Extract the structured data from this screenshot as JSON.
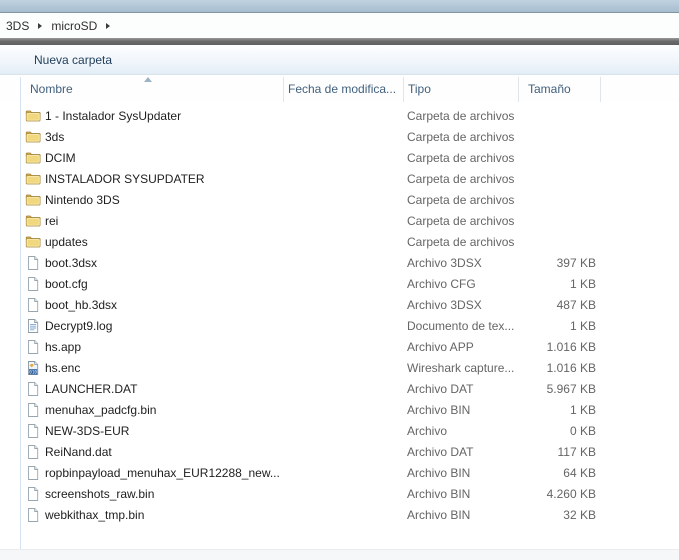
{
  "breadcrumb": {
    "items": [
      "3DS",
      "microSD"
    ]
  },
  "toolbar": {
    "buttons": [
      {
        "label": "Nueva carpeta"
      }
    ]
  },
  "list": {
    "columns": [
      {
        "label": "Nombre"
      },
      {
        "label": "Fecha de modifica..."
      },
      {
        "label": "Tipo"
      },
      {
        "label": "Tamaño"
      }
    ],
    "sort": {
      "column": "Nombre",
      "direction": "asc"
    },
    "files": [
      {
        "name": "1 - Instalador SysUpdater",
        "type": "Carpeta de archivos",
        "size": "",
        "icon": "folder"
      },
      {
        "name": "3ds",
        "type": "Carpeta de archivos",
        "size": "",
        "icon": "folder"
      },
      {
        "name": "DCIM",
        "type": "Carpeta de archivos",
        "size": "",
        "icon": "folder"
      },
      {
        "name": "INSTALADOR SYSUPDATER",
        "type": "Carpeta de archivos",
        "size": "",
        "icon": "folder"
      },
      {
        "name": "Nintendo 3DS",
        "type": "Carpeta de archivos",
        "size": "",
        "icon": "folder"
      },
      {
        "name": "rei",
        "type": "Carpeta de archivos",
        "size": "",
        "icon": "folder"
      },
      {
        "name": "updates",
        "type": "Carpeta de archivos",
        "size": "",
        "icon": "folder"
      },
      {
        "name": "boot.3dsx",
        "type": "Archivo 3DSX",
        "size": "397 KB",
        "icon": "file"
      },
      {
        "name": "boot.cfg",
        "type": "Archivo CFG",
        "size": "1 KB",
        "icon": "file"
      },
      {
        "name": "boot_hb.3dsx",
        "type": "Archivo 3DSX",
        "size": "487 KB",
        "icon": "file"
      },
      {
        "name": "Decrypt9.log",
        "type": "Documento de tex...",
        "size": "1 KB",
        "icon": "text-document"
      },
      {
        "name": "hs.app",
        "type": "Archivo APP",
        "size": "1.016 KB",
        "icon": "file"
      },
      {
        "name": "hs.enc",
        "type": "Wireshark capture...",
        "size": "1.016 KB",
        "icon": "wireshark"
      },
      {
        "name": "LAUNCHER.DAT",
        "type": "Archivo DAT",
        "size": "5.967 KB",
        "icon": "file"
      },
      {
        "name": "menuhax_padcfg.bin",
        "type": "Archivo BIN",
        "size": "1 KB",
        "icon": "file"
      },
      {
        "name": "NEW-3DS-EUR",
        "type": "Archivo",
        "size": "0 KB",
        "icon": "file"
      },
      {
        "name": "ReiNand.dat",
        "type": "Archivo DAT",
        "size": "117 KB",
        "icon": "file"
      },
      {
        "name": "ropbinpayload_menuhax_EUR12288_new...",
        "type": "Archivo BIN",
        "size": "64 KB",
        "icon": "file"
      },
      {
        "name": "screenshots_raw.bin",
        "type": "Archivo BIN",
        "size": "4.260 KB",
        "icon": "file"
      },
      {
        "name": "webkithax_tmp.bin",
        "type": "Archivo BIN",
        "size": "32 KB",
        "icon": "file"
      }
    ]
  },
  "colors": {
    "titlebar": "#b4c7d7",
    "toolbar_text": "#1f3d5a",
    "header_text": "#41607e",
    "folder_yellow": "#f1d87e",
    "wireshark_blue": "#2a5d9f",
    "secondary_text": "#656565"
  }
}
